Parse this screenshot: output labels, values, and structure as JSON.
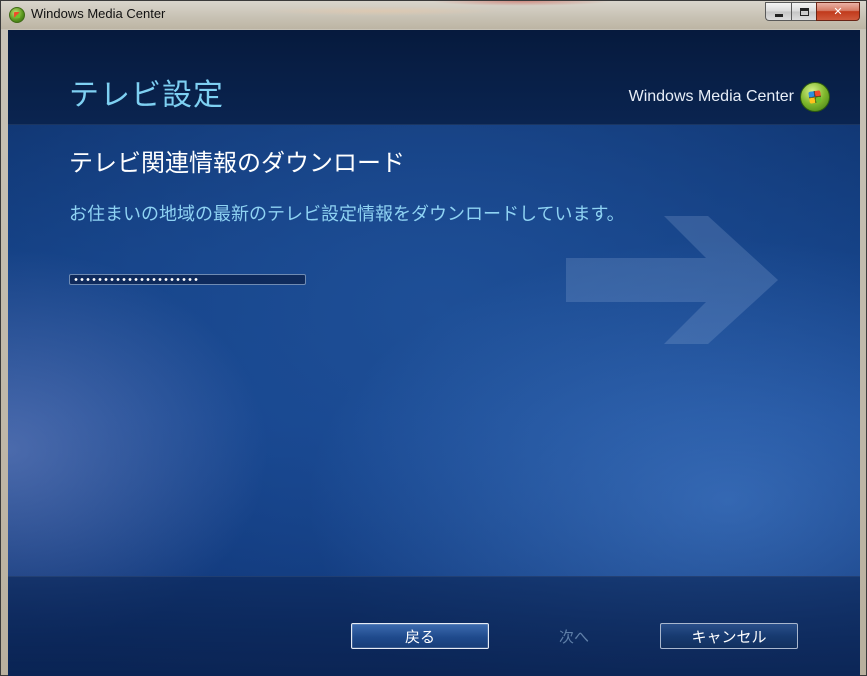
{
  "window": {
    "title": "Windows Media Center",
    "caption": {
      "minimize": "minimize-icon",
      "maximize": "maximize-icon",
      "close_glyph": "✕"
    }
  },
  "header": {
    "title": "テレビ設定",
    "brand": "Windows Media Center"
  },
  "main": {
    "section_title": "テレビ関連情報のダウンロード",
    "description": "お住まいの地域の最新のテレビ設定情報をダウンロードしています。",
    "progress": {
      "state": "indeterminate",
      "fill_fraction": 0.55
    }
  },
  "footer": {
    "back_label": "戻る",
    "next_label": "次へ",
    "cancel_label": "キャンセル"
  },
  "colors": {
    "accent_text": "#7ed0f2",
    "description_text": "#8fd3f3",
    "disabled_text": "#5f7fa8",
    "background": "#123d80"
  }
}
